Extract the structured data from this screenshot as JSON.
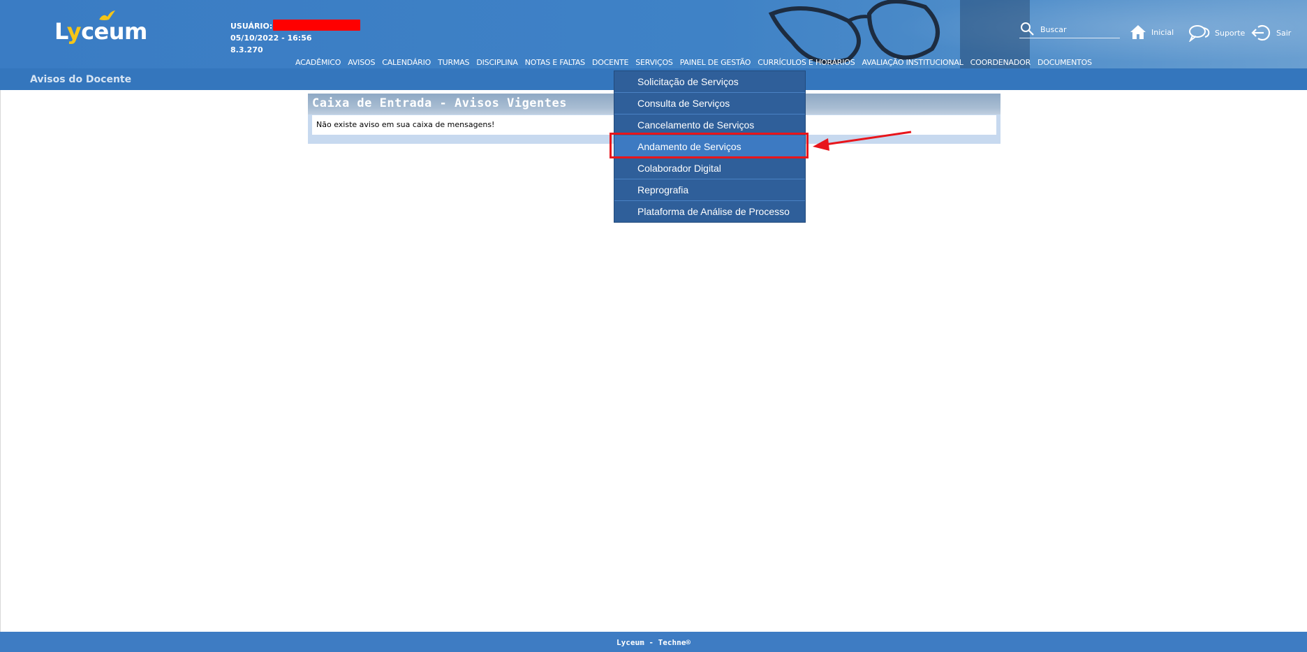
{
  "header": {
    "logo_text_1": "L",
    "logo_text_2": "y",
    "logo_text_3": "ceum",
    "user_label": "USUÁRIO:",
    "datetime": "05/10/2022 - 16:56",
    "version": "8.3.270",
    "search_placeholder": "Buscar",
    "links": {
      "home": "Inicial",
      "support": "Suporte",
      "exit": "Sair"
    }
  },
  "nav": {
    "items": [
      "ACADÊMICO",
      "AVISOS",
      "CALENDÁRIO",
      "TURMAS",
      "DISCIPLINA",
      "NOTAS E FALTAS",
      "DOCENTE",
      "SERVIÇOS",
      "PAINEL DE GESTÃO",
      "CURRÍCULOS E HORÁRIOS",
      "AVALIAÇÃO INSTITUCIONAL",
      "COORDENADOR",
      "DOCUMENTOS"
    ]
  },
  "subbar": {
    "title": "Avisos do Docente"
  },
  "inbox": {
    "title": "Caixa de Entrada - Avisos Vigentes",
    "message": "Não existe aviso em sua caixa de mensagens!"
  },
  "services_menu": {
    "items": [
      "Solicitação de Serviços",
      "Consulta de Serviços",
      "Cancelamento de Serviços",
      "Andamento de Serviços",
      "Colaborador Digital",
      "Reprografia",
      "Plataforma de Análise de Processo"
    ],
    "active_index": 3
  },
  "footer": {
    "text": "Lyceum - Techne®"
  },
  "colors": {
    "header": "#3f82c6",
    "subbar": "#3476bd",
    "menu": "#2f5f9a",
    "highlight": "#e8151b",
    "redaction": "#ff0000"
  }
}
